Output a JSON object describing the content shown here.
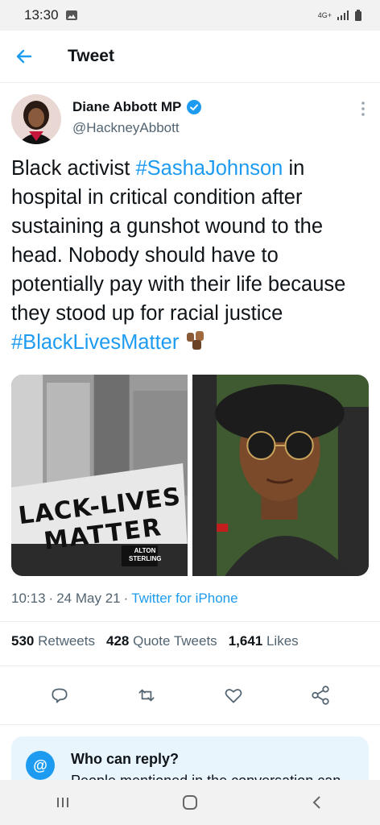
{
  "status_bar": {
    "time": "13:30",
    "network": "4G+"
  },
  "header": {
    "title": "Tweet"
  },
  "author": {
    "display_name": "Diane Abbott MP",
    "handle": "@HackneyAbbott"
  },
  "tweet": {
    "p1": "Black activist ",
    "tag1": "#SashaJohnson",
    "p2": " in hospital in critical condition after sustaining a gunshot wound to the head. Nobody should have to potentially pay with their life because they stood up for racial justice ",
    "tag2": "#BlackLivesMatter"
  },
  "media": {
    "banner_line1": "LACK-LIVES",
    "banner_line2": "MATTER",
    "sign": "ALTON STERLING"
  },
  "meta": {
    "time": "10:13",
    "sep1": "·",
    "date": "24 May 21",
    "sep2": "·",
    "source": "Twitter for iPhone"
  },
  "stats": {
    "retweets_count": "530",
    "retweets_label": "Retweets",
    "quotes_count": "428",
    "quotes_label": "Quote Tweets",
    "likes_count": "1,641",
    "likes_label": "Likes"
  },
  "reply_card": {
    "heading": "Who can reply?",
    "desc": "People mentioned in the conversation can reply"
  },
  "colors": {
    "accent": "#1d9bf0",
    "muted": "#536471"
  },
  "icons": [
    "back-arrow-icon",
    "verified-icon",
    "more-icon",
    "reply-icon",
    "retweet-icon",
    "like-icon",
    "share-icon",
    "at-icon",
    "recents-icon",
    "home-icon",
    "nav-back-icon"
  ]
}
